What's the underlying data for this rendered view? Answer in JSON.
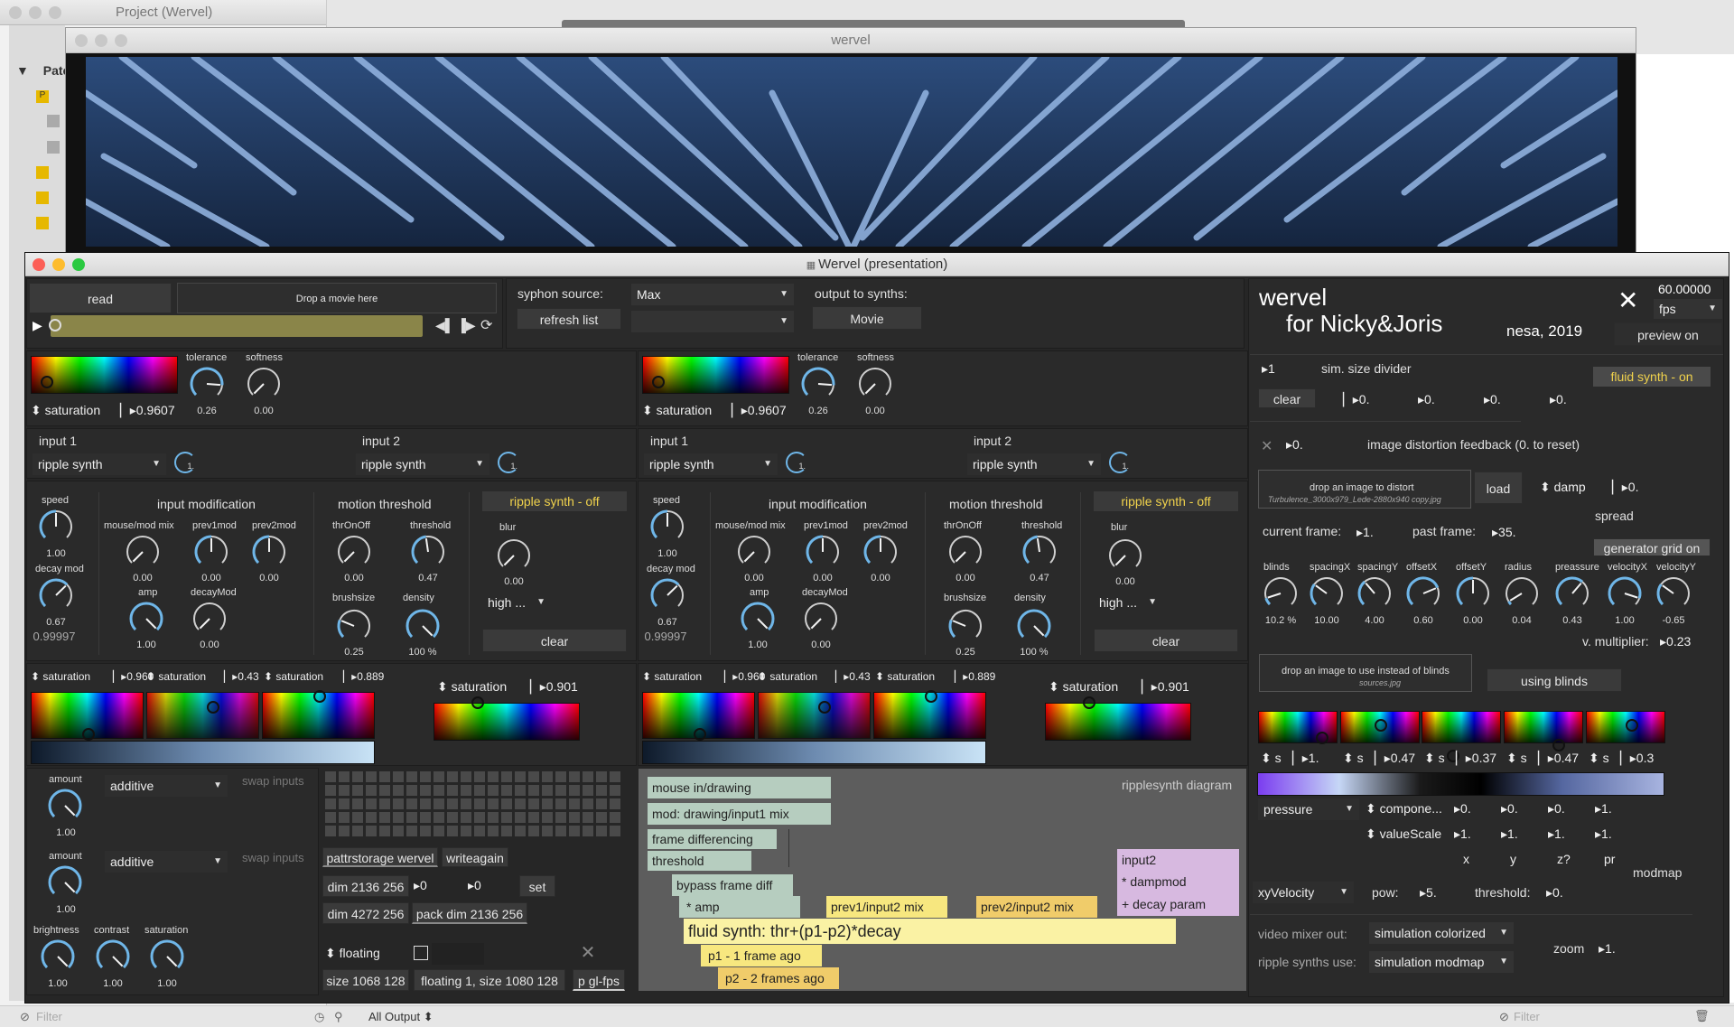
{
  "back_window": {
    "title": "Project (Wervel)",
    "tree_label": "Patc"
  },
  "top_window": {
    "title": "wervel"
  },
  "main_window": {
    "title": "Wervel (presentation)"
  },
  "colors": {
    "accent": "#f0d24c",
    "knob": "#6fb6e8",
    "lavender": "#d7b9e0",
    "sage": "#b6cdbf",
    "yellow": "#f7e77f"
  },
  "movie": {
    "read": "read",
    "drop": "Drop a movie here",
    "syphon_label": "syphon source:",
    "syphon_value": "Max",
    "refresh": "refresh list",
    "output_label": "output to synths:",
    "output_button": "Movie"
  },
  "left": {
    "color_sat_label": "saturation",
    "color_sat_value": "0.9607",
    "tolerance": "tolerance",
    "tolerance_val": "0.26",
    "softness": "softness",
    "softness_val": "0.00",
    "input1": "input 1",
    "input2": "input 2",
    "input1_menu": "ripple synth",
    "input2_menu": "ripple synth",
    "badge": "1.",
    "speed": "speed",
    "speed_val": "1.00",
    "decay_mod": "decay mod",
    "decay_val": "0.67",
    "decay_num": "0.99997",
    "input_mod": "input modification",
    "mouse_mod_mix": "mouse/mod mix",
    "mouse_val": "0.00",
    "prev1mod": "prev1mod",
    "prev1_val": "0.00",
    "prev2mod": "prev2mod",
    "prev2_val": "0.00",
    "amp": "amp",
    "amp_val": "1.00",
    "decaymod2": "decayMod",
    "decaymod2_val": "0.00",
    "motion": "motion threshold",
    "thronoff": "thrOnOff",
    "thronoff_val": "0.00",
    "threshold": "threshold",
    "threshold_val": "0.47",
    "brushsize": "brushsize",
    "brushsize_val": "0.25",
    "density": "density",
    "density_val": "100 %",
    "ripple_off": "ripple synth - off",
    "blur": "blur",
    "blur_val": "0.00",
    "quality": "high ...",
    "clear": "clear",
    "sat1": "saturation",
    "sat1_val": "0.960",
    "sat2": "saturation",
    "sat2_val": "0.43",
    "sat3": "saturation",
    "sat3_val": "0.889",
    "sat4": "saturation",
    "sat4_val": "0.901"
  },
  "right": {
    "color_sat_label": "saturation",
    "color_sat_value": "0.9607",
    "tolerance": "tolerance",
    "tolerance_val": "0.26",
    "softness": "softness",
    "softness_val": "0.00",
    "input1": "input 1",
    "input2": "input 2",
    "input1_menu": "ripple synth",
    "input2_menu": "ripple synth",
    "badge": "1.",
    "speed": "speed",
    "speed_val": "1.00",
    "decay_mod": "decay mod",
    "decay_val": "0.67",
    "decay_num": "0.99997",
    "input_mod": "input modification",
    "mouse_mod_mix": "mouse/mod mix",
    "mouse_val": "0.00",
    "prev1mod": "prev1mod",
    "prev1_val": "0.00",
    "prev2mod": "prev2mod",
    "prev2_val": "0.00",
    "amp": "amp",
    "amp_val": "1.00",
    "decaymod2": "decayMod",
    "decaymod2_val": "0.00",
    "motion": "motion threshold",
    "thronoff": "thrOnOff",
    "thronoff_val": "0.00",
    "threshold": "threshold",
    "threshold_val": "0.47",
    "brushsize": "brushsize",
    "brushsize_val": "0.25",
    "density": "density",
    "density_val": "100 %",
    "ripple_off": "ripple synth - off",
    "blur": "blur",
    "blur_val": "0.00",
    "quality": "high ...",
    "clear": "clear",
    "sat1": "saturation",
    "sat1_val": "0.960",
    "sat2": "saturation",
    "sat2_val": "0.43",
    "sat3": "saturation",
    "sat3_val": "0.889",
    "sat4": "saturation",
    "sat4_val": "0.901"
  },
  "mixer": {
    "amount": "amount",
    "amount1_val": "1.00",
    "amount2_val": "1.00",
    "mode1": "additive",
    "mode2": "additive",
    "swap": "swap inputs",
    "brightness": "brightness",
    "bright_val": "1.00",
    "contrast": "contrast",
    "contrast_val": "1.00",
    "saturation": "saturation",
    "sat_val": "1.00",
    "pattr": "pattrstorage wervel",
    "writeagain": "writeagain",
    "dim1": "dim 2136 256",
    "n0a": "0",
    "n0b": "0",
    "set": "set",
    "dim2": "dim 4272 256",
    "packdim": "pack dim 2136 256",
    "floating": "floating",
    "size1": "size 1068 128",
    "floating2": "floating 1, size 1080 128",
    "pgl": "p gl-fps"
  },
  "diagram": {
    "title": "ripplesynth diagram",
    "mouse": "mouse in/drawing",
    "mod": "mod: drawing/input1 mix",
    "framediff": "frame differencing",
    "threshold": "threshold",
    "bypass": "bypass frame diff",
    "amp": "* amp",
    "prev1": "prev1/input2 mix",
    "prev2": "prev2/input2 mix",
    "input2": "input2",
    "dampmod": "* dampmod",
    "decayparam": "+ decay param",
    "fluid": "fluid synth: thr+(p1-p2)*decay",
    "p1": "p1 - 1 frame ago",
    "p2": "p2 - 2 frames ago"
  },
  "side": {
    "title": "wervel",
    "subtitle": "for Nicky&Joris",
    "credit": "nesa, 2019",
    "fps_val": "60.00000",
    "fps": "fps",
    "preview": "preview on",
    "sim_val": "1",
    "sim_label": "sim. size divider",
    "fluid_on": "fluid synth - on",
    "clear": "clear",
    "z1": "0.",
    "z2": "0.",
    "z3": "0.",
    "z4": "0.",
    "distort_val": "0.",
    "distort_label": "image distortion feedback (0. to reset)",
    "drop_distort": "drop an image to distort",
    "distort_file": "Turbulence_3000x979_Lede-2880x940 copy.jpg",
    "load": "load",
    "damp": "damp",
    "damp_val": "0.",
    "spread": "spread",
    "current_frame": "current frame:",
    "current_val": "1.",
    "past_frame": "past frame:",
    "past_val": "35.",
    "gen_grid": "generator grid on",
    "knobs": [
      {
        "label": "blinds",
        "val": "10.2 %"
      },
      {
        "label": "spacingX",
        "val": "10.00"
      },
      {
        "label": "spacingY",
        "val": "4.00"
      },
      {
        "label": "offsetX",
        "val": "0.60"
      },
      {
        "label": "offsetY",
        "val": "0.00"
      },
      {
        "label": "radius",
        "val": "0.04"
      },
      {
        "label": "preassure",
        "val": "0.43"
      },
      {
        "label": "velocityX",
        "val": "1.00"
      },
      {
        "label": "velocityY",
        "val": "-0.65"
      }
    ],
    "vmult_label": "v. multiplier:",
    "vmult_val": "0.23",
    "drop_blinds": "drop an image to use instead of blinds",
    "blinds_file": "sources.jpg",
    "using_blinds": "using blinds",
    "s_label": "s",
    "s_vals": [
      "1.",
      "0.47",
      "0.37",
      "0.47",
      "0.3"
    ],
    "pressure": "pressure",
    "component": "compone...",
    "c_vals": [
      "0.",
      "0.",
      "0.",
      "1."
    ],
    "valuescale": "valueScale",
    "v_vals": [
      "1.",
      "1.",
      "1.",
      "1."
    ],
    "axes": [
      "x",
      "y",
      "z?",
      "pr"
    ],
    "modmap": "modmap",
    "xyvel": "xyVelocity",
    "pow": "pow:",
    "pow_val": "5.",
    "thr": "threshold:",
    "thr_val": "0.",
    "vmix_label": "video mixer out:",
    "vmix_val": "simulation colorized",
    "ripple_use_label": "ripple synths use:",
    "ripple_use_val": "simulation modmap",
    "zoom": "zoom",
    "zoom_val": "1."
  },
  "statusbar": {
    "filter": "Filter",
    "output": "All Output",
    "filter2": "Filter"
  }
}
